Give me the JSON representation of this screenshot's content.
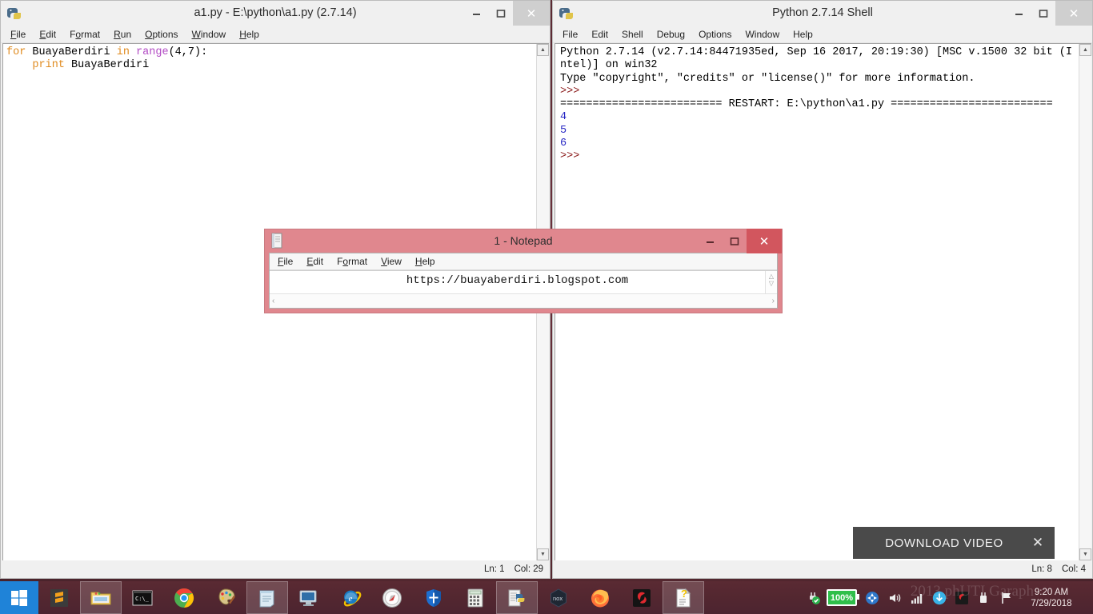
{
  "desktop": {
    "background_color": "#552830"
  },
  "idle_editor": {
    "title": "a1.py - E:\\python\\a1.py (2.7.14)",
    "icon": "python-idle-icon",
    "menus": [
      {
        "label": "File",
        "accel": "F"
      },
      {
        "label": "Edit",
        "accel": "E"
      },
      {
        "label": "Format",
        "accel": "o"
      },
      {
        "label": "Run",
        "accel": "R"
      },
      {
        "label": "Options",
        "accel": "O"
      },
      {
        "label": "Window",
        "accel": "W"
      },
      {
        "label": "Help",
        "accel": "H"
      }
    ],
    "code_lines": [
      [
        {
          "text": "for",
          "type": "keyword"
        },
        {
          "text": " BuayaBerdiri ",
          "type": "plain"
        },
        {
          "text": "in",
          "type": "keyword"
        },
        {
          "text": " ",
          "type": "plain"
        },
        {
          "text": "range",
          "type": "builtin"
        },
        {
          "text": "(4,7):",
          "type": "plain"
        }
      ],
      [
        {
          "text": "    ",
          "type": "plain"
        },
        {
          "text": "print",
          "type": "keyword"
        },
        {
          "text": " BuayaBerdiri",
          "type": "plain"
        }
      ]
    ],
    "status": {
      "line_label": "Ln: 1",
      "col_label": "Col: 29"
    },
    "window_buttons": {
      "minimize": "–",
      "maximize": "☐",
      "close": "✕"
    },
    "colors": {
      "keyword": "#E08B1F",
      "builtin": "#B24BC4",
      "text": "#000000"
    }
  },
  "idle_shell": {
    "title": "Python 2.7.14 Shell",
    "icon": "python-idle-icon",
    "menus": [
      {
        "label": "File"
      },
      {
        "label": "Edit"
      },
      {
        "label": "Shell"
      },
      {
        "label": "Debug"
      },
      {
        "label": "Options"
      },
      {
        "label": "Window"
      },
      {
        "label": "Help"
      }
    ],
    "output_lines": [
      {
        "text": "Python 2.7.14 (v2.7.14:84471935ed, Sep 16 2017, 20:19:30) [MSC v.1500 32 bit (Intel)] on win32",
        "type": "plain"
      },
      {
        "text": "Type \"copyright\", \"credits\" or \"license()\" for more information.",
        "type": "plain"
      },
      {
        "text": ">>>",
        "type": "prompt"
      },
      {
        "text": "========================= RESTART: E:\\python\\a1.py =========================",
        "type": "plain"
      },
      {
        "text": "4",
        "type": "output"
      },
      {
        "text": "5",
        "type": "output"
      },
      {
        "text": "6",
        "type": "output"
      },
      {
        "text": ">>>",
        "type": "prompt"
      }
    ],
    "status": {
      "line_label": "Ln: 8",
      "col_label": "Col: 4"
    },
    "window_buttons": {
      "minimize": "–",
      "maximize": "☐",
      "close": "✕"
    },
    "colors": {
      "prompt": "#8b1a1a",
      "output": "#2727c4"
    }
  },
  "notepad": {
    "title": "1 - Notepad",
    "icon": "notepad-icon",
    "titlebar_color": "#e0878e",
    "close_color": "#d2565e",
    "menus": [
      {
        "label": "File",
        "accel": "F"
      },
      {
        "label": "Edit",
        "accel": "E"
      },
      {
        "label": "Format",
        "accel": "o"
      },
      {
        "label": "View",
        "accel": "V"
      },
      {
        "label": "Help",
        "accel": "H"
      }
    ],
    "content": "https://buayaberdiri.blogspot.com",
    "window_buttons": {
      "minimize": "–",
      "maximize": "☐",
      "close": "✕"
    }
  },
  "download_overlay": {
    "label": "DOWNLOAD VIDEO",
    "close": "✕",
    "background_color": "#4a4a4a"
  },
  "taskbar": {
    "start_icon": "windows-start-icon",
    "items": [
      {
        "name": "sublime-text-icon",
        "running": false
      },
      {
        "name": "file-explorer-icon",
        "running": true
      },
      {
        "name": "command-prompt-icon",
        "running": false
      },
      {
        "name": "google-chrome-icon",
        "running": false
      },
      {
        "name": "paint-icon",
        "running": false
      },
      {
        "name": "notepad-icon",
        "running": true
      },
      {
        "name": "remote-desktop-icon",
        "running": false
      },
      {
        "name": "internet-explorer-icon",
        "running": false
      },
      {
        "name": "opera-icon",
        "running": false
      },
      {
        "name": "windows-defender-icon",
        "running": false
      },
      {
        "name": "calculator-icon",
        "running": false
      },
      {
        "name": "python-idle-icon",
        "running": true
      },
      {
        "name": "nox-player-icon",
        "running": false
      },
      {
        "name": "mozilla-firefox-icon",
        "running": false
      },
      {
        "name": "gom-player-icon",
        "running": false
      },
      {
        "name": "help-document-icon",
        "running": true
      }
    ],
    "tray": {
      "battery_percent": "100%",
      "battery_color": "#2fbf4a",
      "icons": [
        "action-center-icon",
        "volume-icon",
        "network-signal-icon",
        "safely-remove-icon",
        "idm-icon",
        "gom-tray-icon",
        "usb-device-icon",
        "flag-icon"
      ]
    },
    "watermark": "2013 phUTI Garaph",
    "clock": {
      "time": "9:20 AM",
      "date": "7/29/2018"
    }
  }
}
